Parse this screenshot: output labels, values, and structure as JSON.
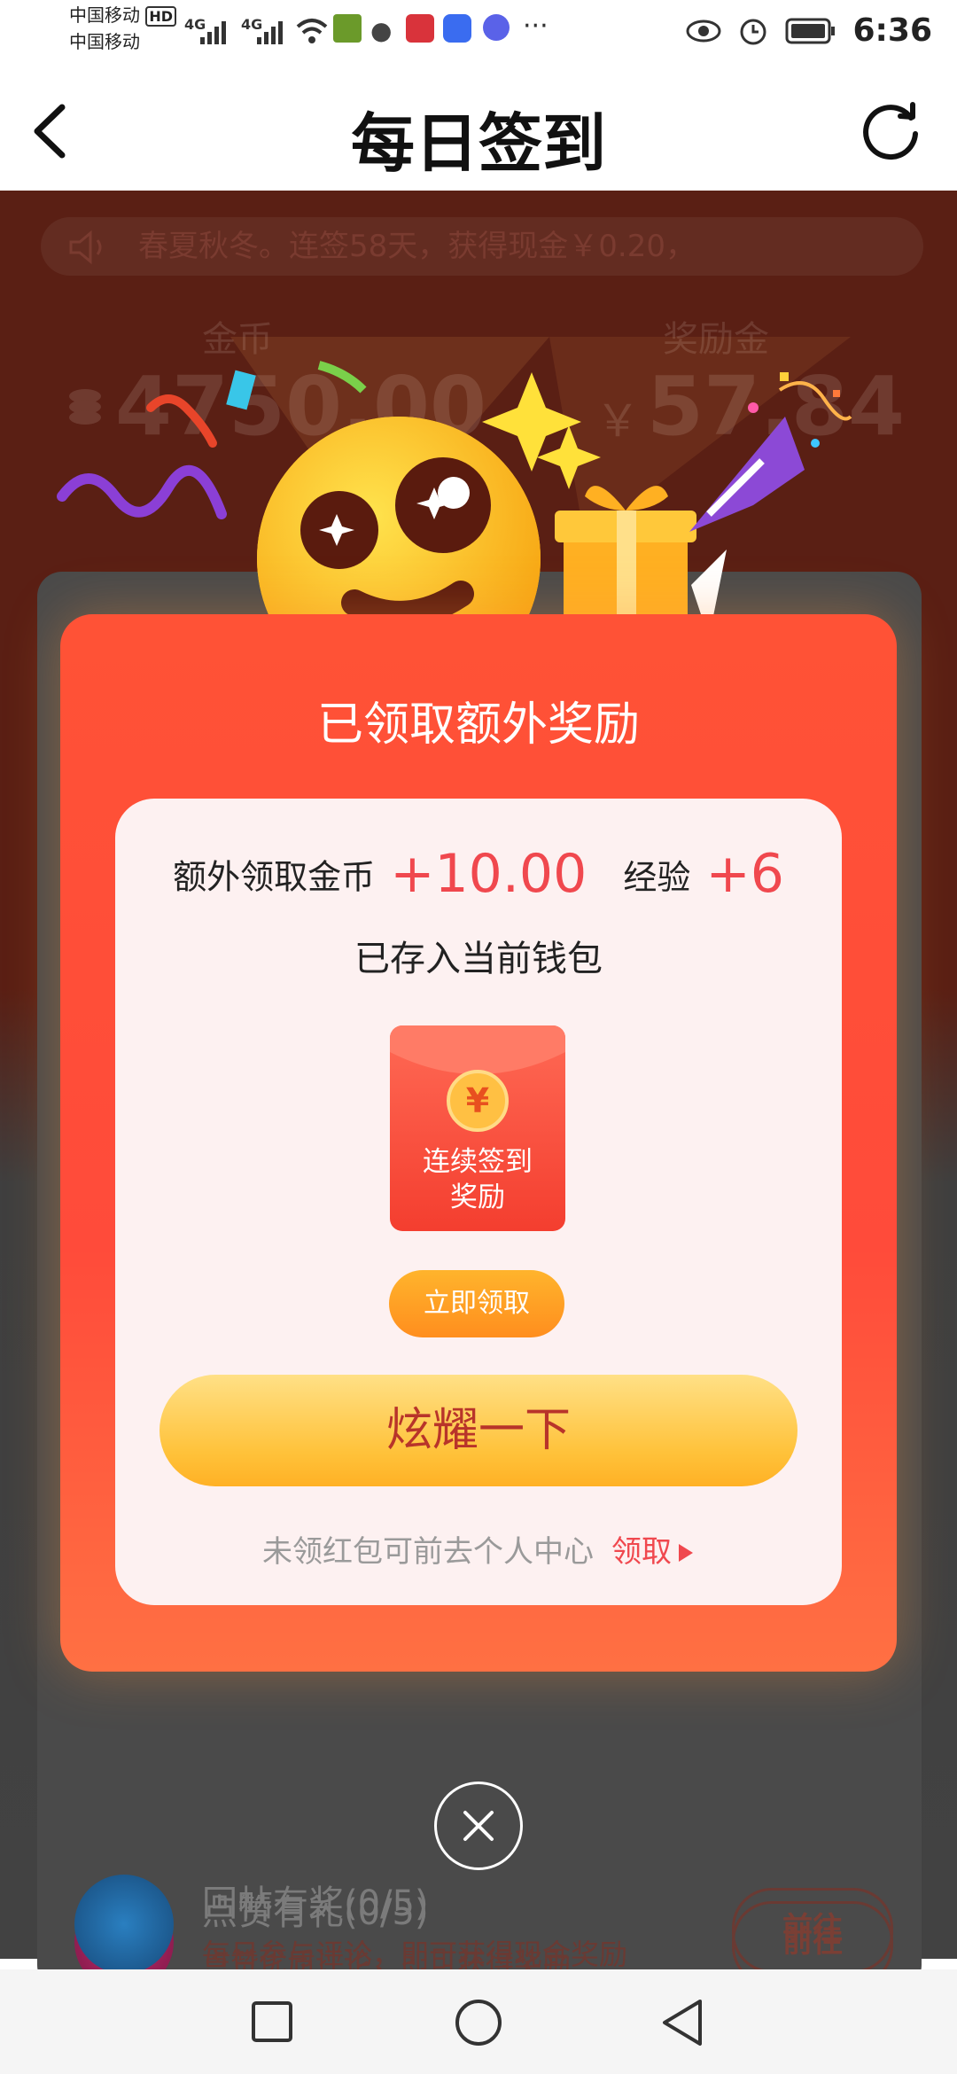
{
  "status_bar": {
    "carrier_1": "中国移动",
    "hd": "HD",
    "carrier_2": "中国移动",
    "signal_1": "4G",
    "signal_2": "4G",
    "more": "···",
    "time": "6:36"
  },
  "header": {
    "title": "每日签到"
  },
  "background": {
    "notice": "春夏秋冬。连签58天，获得现金￥0.20，",
    "coins_label": "金币",
    "coins_value": "4750.00",
    "reward_label": "奖励金",
    "reward_currency": "￥",
    "reward_value": "57.84",
    "tasks": [
      {
        "title": "点赞有礼(0/5)",
        "subtitle": "点赞优质评论，即可获得奖励",
        "button": "前往"
      },
      {
        "title": "回帖有奖(0/5)",
        "subtitle": "每日参与评论，即可获得现金奖励",
        "button": "前往"
      }
    ]
  },
  "modal": {
    "title": "已领取额外奖励",
    "coins_label": "额外领取金币",
    "coins_value": "+10.00",
    "exp_label": "经验",
    "exp_value": "+6",
    "stored_text": "已存入当前钱包",
    "envelope_symbol": "¥",
    "envelope_label": "连续签到奖励",
    "claim_button": "立即领取",
    "show_off_button": "炫耀一下",
    "footer_text": "未领红包可前去个人中心",
    "footer_link": "领取"
  },
  "colors": {
    "modal_red": "#ff5236",
    "accent_red": "#f0484e",
    "button_yellow": "#ffc23a",
    "claim_orange": "#ff9a22"
  },
  "icons": [
    "back-icon",
    "refresh-icon",
    "speaker-icon",
    "coin-stack-icon",
    "red-envelope-icon",
    "close-icon",
    "nav-recent-icon",
    "nav-home-icon",
    "nav-back-icon"
  ]
}
